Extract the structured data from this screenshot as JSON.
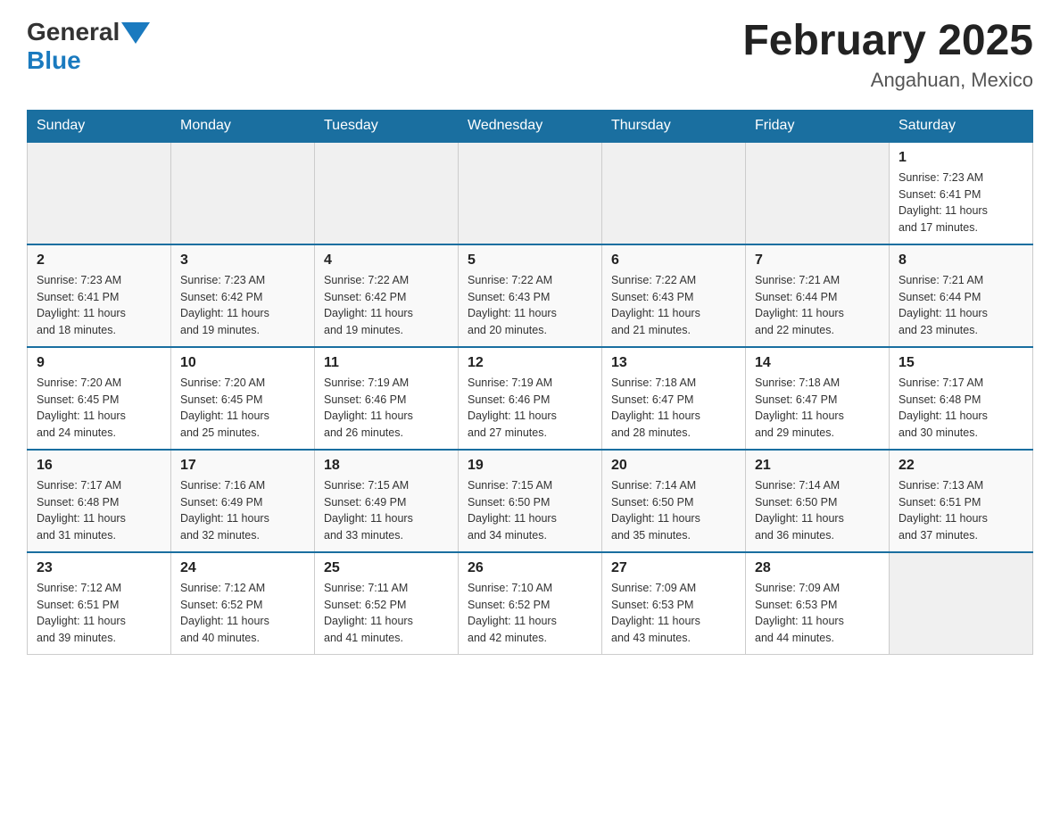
{
  "header": {
    "logo_general": "General",
    "logo_blue": "Blue",
    "title": "February 2025",
    "subtitle": "Angahuan, Mexico"
  },
  "days_of_week": [
    "Sunday",
    "Monday",
    "Tuesday",
    "Wednesday",
    "Thursday",
    "Friday",
    "Saturday"
  ],
  "weeks": [
    [
      {
        "day": "",
        "info": ""
      },
      {
        "day": "",
        "info": ""
      },
      {
        "day": "",
        "info": ""
      },
      {
        "day": "",
        "info": ""
      },
      {
        "day": "",
        "info": ""
      },
      {
        "day": "",
        "info": ""
      },
      {
        "day": "1",
        "info": "Sunrise: 7:23 AM\nSunset: 6:41 PM\nDaylight: 11 hours\nand 17 minutes."
      }
    ],
    [
      {
        "day": "2",
        "info": "Sunrise: 7:23 AM\nSunset: 6:41 PM\nDaylight: 11 hours\nand 18 minutes."
      },
      {
        "day": "3",
        "info": "Sunrise: 7:23 AM\nSunset: 6:42 PM\nDaylight: 11 hours\nand 19 minutes."
      },
      {
        "day": "4",
        "info": "Sunrise: 7:22 AM\nSunset: 6:42 PM\nDaylight: 11 hours\nand 19 minutes."
      },
      {
        "day": "5",
        "info": "Sunrise: 7:22 AM\nSunset: 6:43 PM\nDaylight: 11 hours\nand 20 minutes."
      },
      {
        "day": "6",
        "info": "Sunrise: 7:22 AM\nSunset: 6:43 PM\nDaylight: 11 hours\nand 21 minutes."
      },
      {
        "day": "7",
        "info": "Sunrise: 7:21 AM\nSunset: 6:44 PM\nDaylight: 11 hours\nand 22 minutes."
      },
      {
        "day": "8",
        "info": "Sunrise: 7:21 AM\nSunset: 6:44 PM\nDaylight: 11 hours\nand 23 minutes."
      }
    ],
    [
      {
        "day": "9",
        "info": "Sunrise: 7:20 AM\nSunset: 6:45 PM\nDaylight: 11 hours\nand 24 minutes."
      },
      {
        "day": "10",
        "info": "Sunrise: 7:20 AM\nSunset: 6:45 PM\nDaylight: 11 hours\nand 25 minutes."
      },
      {
        "day": "11",
        "info": "Sunrise: 7:19 AM\nSunset: 6:46 PM\nDaylight: 11 hours\nand 26 minutes."
      },
      {
        "day": "12",
        "info": "Sunrise: 7:19 AM\nSunset: 6:46 PM\nDaylight: 11 hours\nand 27 minutes."
      },
      {
        "day": "13",
        "info": "Sunrise: 7:18 AM\nSunset: 6:47 PM\nDaylight: 11 hours\nand 28 minutes."
      },
      {
        "day": "14",
        "info": "Sunrise: 7:18 AM\nSunset: 6:47 PM\nDaylight: 11 hours\nand 29 minutes."
      },
      {
        "day": "15",
        "info": "Sunrise: 7:17 AM\nSunset: 6:48 PM\nDaylight: 11 hours\nand 30 minutes."
      }
    ],
    [
      {
        "day": "16",
        "info": "Sunrise: 7:17 AM\nSunset: 6:48 PM\nDaylight: 11 hours\nand 31 minutes."
      },
      {
        "day": "17",
        "info": "Sunrise: 7:16 AM\nSunset: 6:49 PM\nDaylight: 11 hours\nand 32 minutes."
      },
      {
        "day": "18",
        "info": "Sunrise: 7:15 AM\nSunset: 6:49 PM\nDaylight: 11 hours\nand 33 minutes."
      },
      {
        "day": "19",
        "info": "Sunrise: 7:15 AM\nSunset: 6:50 PM\nDaylight: 11 hours\nand 34 minutes."
      },
      {
        "day": "20",
        "info": "Sunrise: 7:14 AM\nSunset: 6:50 PM\nDaylight: 11 hours\nand 35 minutes."
      },
      {
        "day": "21",
        "info": "Sunrise: 7:14 AM\nSunset: 6:50 PM\nDaylight: 11 hours\nand 36 minutes."
      },
      {
        "day": "22",
        "info": "Sunrise: 7:13 AM\nSunset: 6:51 PM\nDaylight: 11 hours\nand 37 minutes."
      }
    ],
    [
      {
        "day": "23",
        "info": "Sunrise: 7:12 AM\nSunset: 6:51 PM\nDaylight: 11 hours\nand 39 minutes."
      },
      {
        "day": "24",
        "info": "Sunrise: 7:12 AM\nSunset: 6:52 PM\nDaylight: 11 hours\nand 40 minutes."
      },
      {
        "day": "25",
        "info": "Sunrise: 7:11 AM\nSunset: 6:52 PM\nDaylight: 11 hours\nand 41 minutes."
      },
      {
        "day": "26",
        "info": "Sunrise: 7:10 AM\nSunset: 6:52 PM\nDaylight: 11 hours\nand 42 minutes."
      },
      {
        "day": "27",
        "info": "Sunrise: 7:09 AM\nSunset: 6:53 PM\nDaylight: 11 hours\nand 43 minutes."
      },
      {
        "day": "28",
        "info": "Sunrise: 7:09 AM\nSunset: 6:53 PM\nDaylight: 11 hours\nand 44 minutes."
      },
      {
        "day": "",
        "info": ""
      }
    ]
  ]
}
